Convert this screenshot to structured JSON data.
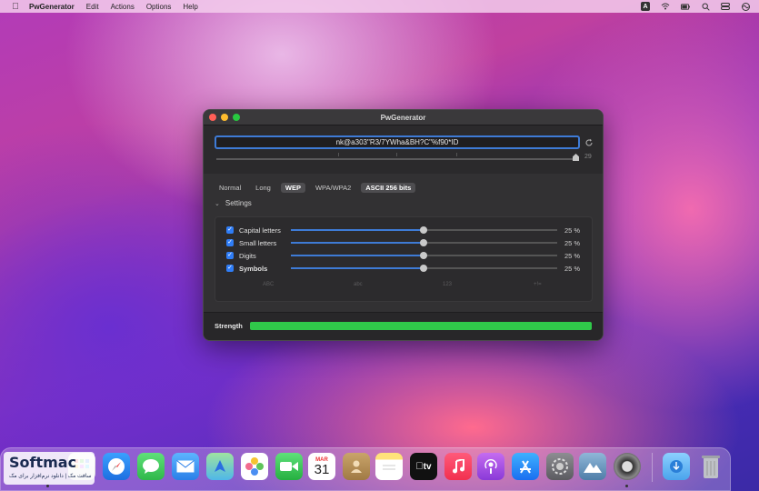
{
  "menubar": {
    "app_name": "PwGenerator",
    "items": [
      "Edit",
      "Actions",
      "Options",
      "Help"
    ],
    "status_keyboard": "A"
  },
  "window": {
    "title": "PwGenerator",
    "password": "nk@a303\"R3/7YWha&BH?C\"%f90*ID",
    "length_value": "29",
    "length_fraction": 0.97
  },
  "tabs": [
    {
      "label": "Normal",
      "active": false
    },
    {
      "label": "Long",
      "active": false
    },
    {
      "label": "WEP",
      "active": true
    },
    {
      "label": "WPA/WPA2",
      "active": false
    },
    {
      "label": "ASCII 256 bits",
      "active": true
    }
  ],
  "settings": {
    "label": "Settings",
    "rows": [
      {
        "label": "Capital letters",
        "checked": true,
        "percent": "25 %",
        "level": 0.5
      },
      {
        "label": "Small letters",
        "checked": true,
        "percent": "25 %",
        "level": 0.5
      },
      {
        "label": "Digits",
        "checked": true,
        "percent": "25 %",
        "level": 0.5
      },
      {
        "label": "Symbols",
        "checked": true,
        "percent": "25 %",
        "level": 0.5
      }
    ],
    "char_labels": [
      "ABC",
      "abc",
      "123",
      "+!="
    ]
  },
  "strength": {
    "label": "Strength",
    "level": 1.0,
    "color": "#30c84a"
  },
  "dock": {
    "calendar_month": "MAR",
    "calendar_day": "31",
    "tv_label": "tv"
  },
  "watermark": {
    "brand": "Softmac",
    "subtitle": "سافت مک | دانلود نرم‌افزار برای مک"
  }
}
